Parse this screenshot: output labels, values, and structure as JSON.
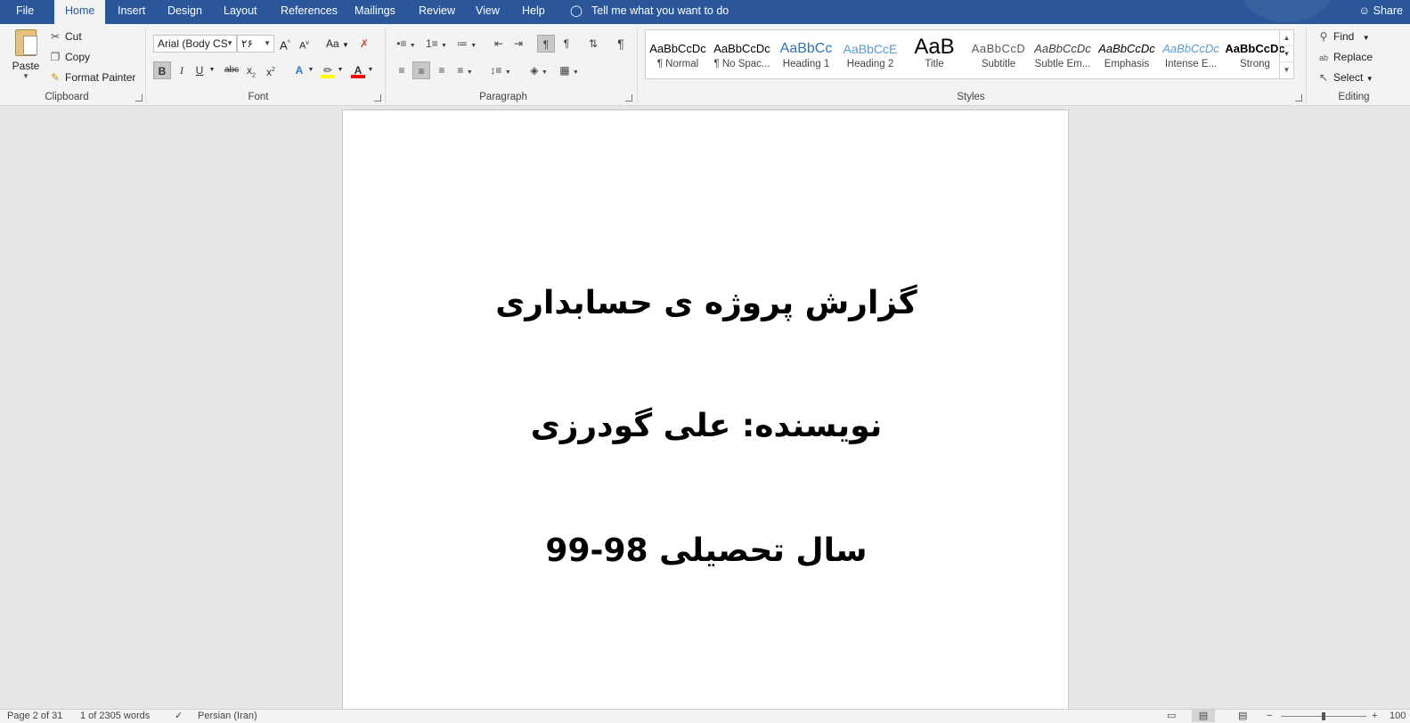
{
  "tabs": {
    "file": "File",
    "home": "Home",
    "insert": "Insert",
    "design": "Design",
    "layout": "Layout",
    "references": "References",
    "mailings": "Mailings",
    "review": "Review",
    "view": "View",
    "help": "Help"
  },
  "tellme": "Tell me what you want to do",
  "share": "Share",
  "clipboard": {
    "paste": "Paste",
    "cut": "Cut",
    "copy": "Copy",
    "format_painter": "Format Painter",
    "label": "Clipboard"
  },
  "font": {
    "name": "Arial (Body CS",
    "size": "۲۶",
    "case": "Aa",
    "label": "Font"
  },
  "paragraph": {
    "label": "Paragraph"
  },
  "styles": {
    "label": "Styles",
    "items": [
      {
        "preview": "AaBbCcDc",
        "name": "¶ Normal"
      },
      {
        "preview": "AaBbCcDc",
        "name": "¶ No Spac..."
      },
      {
        "preview": "AaBbCc",
        "name": "Heading 1"
      },
      {
        "preview": "AaBbCcE",
        "name": "Heading 2"
      },
      {
        "preview": "AaB",
        "name": "Title"
      },
      {
        "preview": "AaBbCcD",
        "name": "Subtitle"
      },
      {
        "preview": "AaBbCcDc",
        "name": "Subtle Em..."
      },
      {
        "preview": "AaBbCcDc",
        "name": "Emphasis"
      },
      {
        "preview": "AaBbCcDc",
        "name": "Intense E..."
      },
      {
        "preview": "AaBbCcDc",
        "name": "Strong"
      }
    ],
    "colors": {
      "heading": "#2e74b5",
      "heading2": "#5b9bd5",
      "intense": "#5b9bd5"
    }
  },
  "editing": {
    "find": "Find",
    "replace": "Replace",
    "select": "Select",
    "label": "Editing"
  },
  "document": {
    "line1": "گزارش پروژه ی حسابداری",
    "line2": "نویسنده: علی گودرزی",
    "line3": "سال تحصیلی 98-99"
  },
  "status": {
    "page": "Page 2 of 31",
    "words": "1 of 2305 words",
    "language": "Persian (Iran)",
    "zoom": "100"
  },
  "colors": {
    "ribbon_blue": "#2b579a",
    "highlight": "#ffff00",
    "font_color": "#ff0000"
  }
}
